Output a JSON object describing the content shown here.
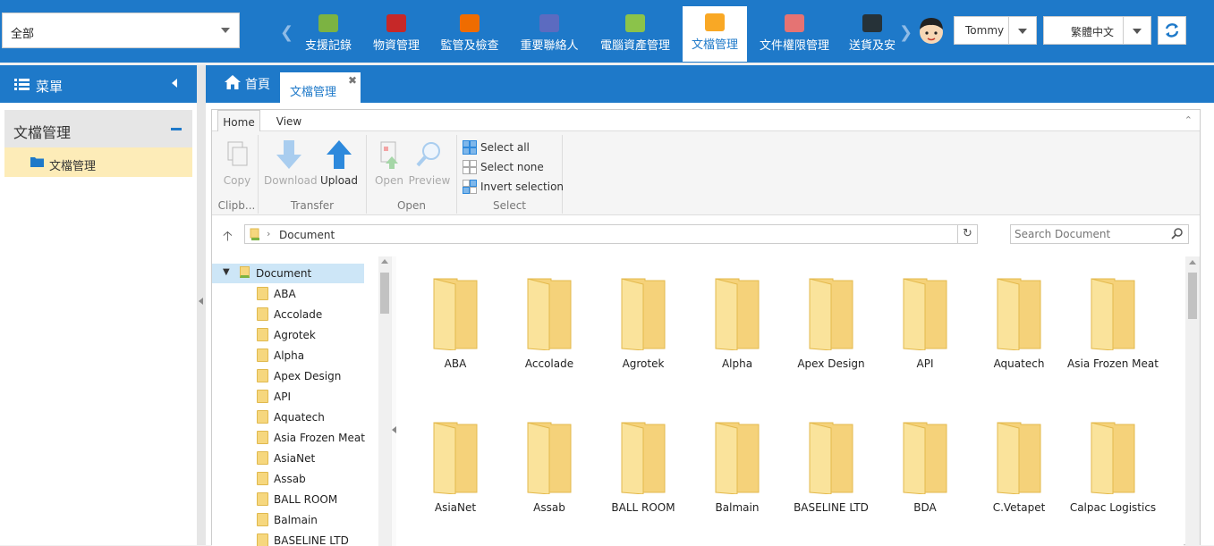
{
  "topbar": {
    "scope_select_value": "全部",
    "modules": [
      {
        "label": "支援記錄",
        "icon": "box-icon",
        "color": "#7cb342"
      },
      {
        "label": "物資管理",
        "icon": "inventory-icon",
        "color": "#c62828"
      },
      {
        "label": "監管及檢查",
        "icon": "calendar-icon",
        "color": "#ef6c00"
      },
      {
        "label": "重要聯絡人",
        "icon": "contact-card-icon",
        "color": "#5c6bc0"
      },
      {
        "label": "電腦資產管理",
        "icon": "money-icon",
        "color": "#8bc34a"
      },
      {
        "label": "文檔管理",
        "icon": "document-folder-icon",
        "color": "#f9a825"
      },
      {
        "label": "文件權限管理",
        "icon": "folder-permission-icon",
        "color": "#e57373"
      },
      {
        "label": "送貨及安",
        "icon": "delivery-truck-icon",
        "color": "#263238"
      }
    ],
    "active_module": "文檔管理",
    "user_name": "Tommy",
    "language": "繁體中文"
  },
  "sidebar": {
    "header": "菜單",
    "group_label": "文檔管理",
    "item_label": "文檔管理"
  },
  "tabs": {
    "home": "首頁",
    "current": "文檔管理",
    "close_glyph": "✖"
  },
  "ribbon": {
    "tabs": [
      "Home",
      "View"
    ],
    "groups": {
      "clipboard": {
        "label": "Clipb...",
        "copy": "Copy"
      },
      "transfer": {
        "label": "Transfer",
        "download": "Download",
        "upload": "Upload"
      },
      "open": {
        "label": "Open",
        "open": "Open",
        "preview": "Preview"
      },
      "select": {
        "label": "Select",
        "select_all": "Select all",
        "select_none": "Select none",
        "invert": "Invert selection"
      }
    }
  },
  "address": {
    "crumb": "Document",
    "search_placeholder": "Search Document"
  },
  "tree": {
    "root": "Document",
    "items": [
      "ABA",
      "Accolade",
      "Agrotek",
      "Alpha",
      "Apex Design",
      "API",
      "Aquatech",
      "Asia Frozen Meat",
      "AsiaNet",
      "Assab",
      "BALL ROOM",
      "Balmain",
      "BASELINE LTD"
    ]
  },
  "grid": {
    "folders": [
      "ABA",
      "Accolade",
      "Agrotek",
      "Alpha",
      "Apex Design",
      "API",
      "Aquatech",
      "Asia Frozen Meat",
      "AsiaNet",
      "Assab",
      "BALL ROOM",
      "Balmain",
      "BASELINE LTD",
      "BDA",
      "C.Vetapet",
      "Calpac Logistics"
    ]
  }
}
